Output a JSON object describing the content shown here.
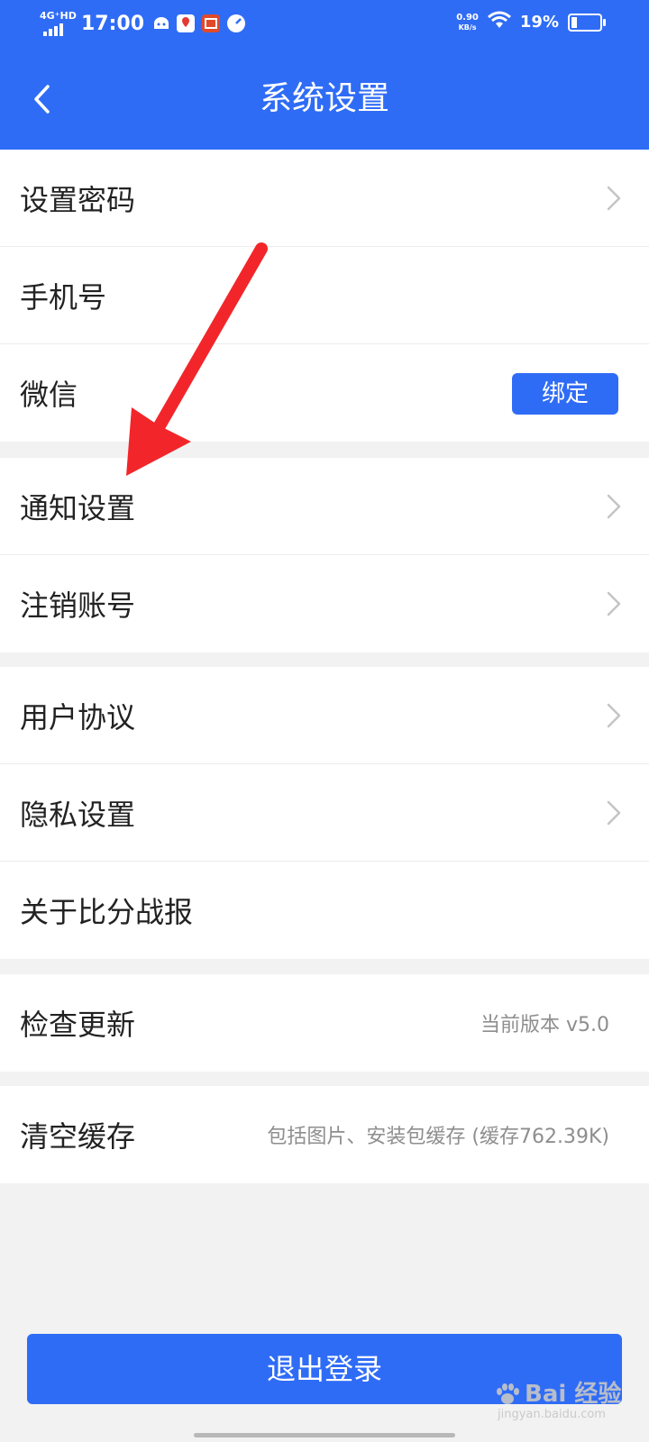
{
  "status_bar": {
    "network": "4G⁺HD",
    "time": "17:00",
    "speed_value": "0.90",
    "speed_unit": "KB/s",
    "battery": "19%",
    "battery_level": 0.19
  },
  "header": {
    "title": "系统设置",
    "back_icon": "chevron-left-icon",
    "background": "#2f6cf6"
  },
  "groups": [
    {
      "rows": [
        {
          "label": "设置密码",
          "chevron": true
        },
        {
          "label": "手机号"
        },
        {
          "label": "微信",
          "button": "绑定"
        }
      ]
    },
    {
      "rows": [
        {
          "label": "通知设置",
          "chevron": true
        },
        {
          "label": "注销账号",
          "chevron": true
        }
      ]
    },
    {
      "rows": [
        {
          "label": "用户协议",
          "chevron": true
        },
        {
          "label": "隐私设置",
          "chevron": true
        },
        {
          "label": "关于比分战报"
        }
      ]
    },
    {
      "rows": [
        {
          "label": "检查更新",
          "value": "当前版本 v5.0"
        }
      ]
    },
    {
      "rows": [
        {
          "label": "清空缓存",
          "value": "包括图片、安装包缓存 (缓存762.39K)"
        }
      ]
    }
  ],
  "logout_label": "退出登录",
  "annotation_color": "#f2262a",
  "watermark": {
    "main": "Bai 经验",
    "sub": "jingyan.baidu.com"
  },
  "colors": {
    "accent": "#2f6cf6",
    "background": "#f2f2f2"
  }
}
